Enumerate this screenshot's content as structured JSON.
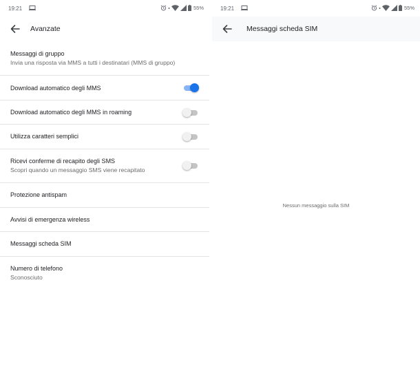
{
  "left_screen": {
    "status_bar": {
      "time": "19:21",
      "battery": "55%"
    },
    "app_bar": {
      "title": "Avanzate"
    },
    "settings": [
      {
        "title": "Messaggi di gruppo",
        "subtitle": "Invia una risposta via MMS a tutti i destinatari (MMS di gruppo)"
      },
      {
        "title": "Download automatico degli MMS",
        "toggle": true
      },
      {
        "title": "Download automatico degli MMS in roaming",
        "toggle": false
      },
      {
        "title": "Utilizza caratteri semplici",
        "toggle": false
      },
      {
        "title": "Ricevi conferme di recapito degli SMS",
        "subtitle": "Scopri quando un messaggio SMS viene recapitato",
        "toggle": false
      },
      {
        "title": "Protezione antispam"
      },
      {
        "title": "Avvisi di emergenza wireless"
      },
      {
        "title": "Messaggi scheda SIM"
      },
      {
        "title": "Numero di telefono",
        "subtitle": "Sconosciuto"
      }
    ]
  },
  "right_screen": {
    "status_bar": {
      "time": "19:21",
      "battery": "55%"
    },
    "app_bar": {
      "title": "Messaggi scheda SIM"
    },
    "empty_message": "Nessun messaggio sulla SIM"
  },
  "icons": {
    "back": "arrow-left-icon",
    "alarm": "alarm-clock-icon",
    "wifi": "wifi-icon",
    "signal": "cell-signal-icon",
    "battery": "battery-icon",
    "screen": "screen-cast-icon"
  },
  "colors": {
    "toggle_on_thumb": "#1a73e8",
    "toggle_on_track": "#8ab4f8",
    "toggle_off_track": "#c4c4c4",
    "divider": "#e3e3e3",
    "app_bar_background_right": "#f8f9fa"
  }
}
